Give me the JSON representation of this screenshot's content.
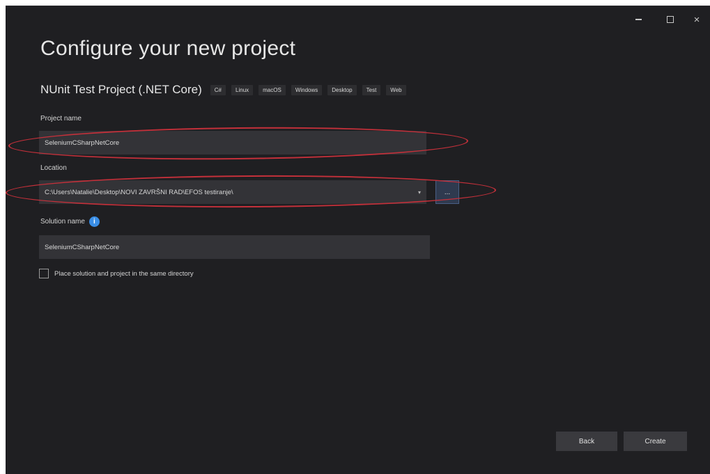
{
  "window_controls": {
    "minimize": "–",
    "maximize": "□",
    "close": "×"
  },
  "page": {
    "title": "Configure your new project"
  },
  "template": {
    "name": "NUnit Test Project (.NET Core)",
    "tags": [
      "C#",
      "Linux",
      "macOS",
      "Windows",
      "Desktop",
      "Test",
      "Web"
    ]
  },
  "project_name": {
    "label": "Project name",
    "value": "SeleniumCSharpNetCore"
  },
  "location": {
    "label": "Location",
    "value": "C:\\Users\\Natalie\\Desktop\\NOVI ZAVRŠNI RAD\\EFOS testiranje\\",
    "browse_label": "..."
  },
  "solution_name": {
    "label": "Solution name",
    "value": "SeleniumCSharpNetCore",
    "info_icon": "info-icon"
  },
  "same_directory": {
    "label": "Place solution and project in the same directory",
    "checked": false
  },
  "footer": {
    "back_label": "Back",
    "create_label": "Create"
  },
  "annotations": {
    "highlight_color": "#c4303a"
  }
}
